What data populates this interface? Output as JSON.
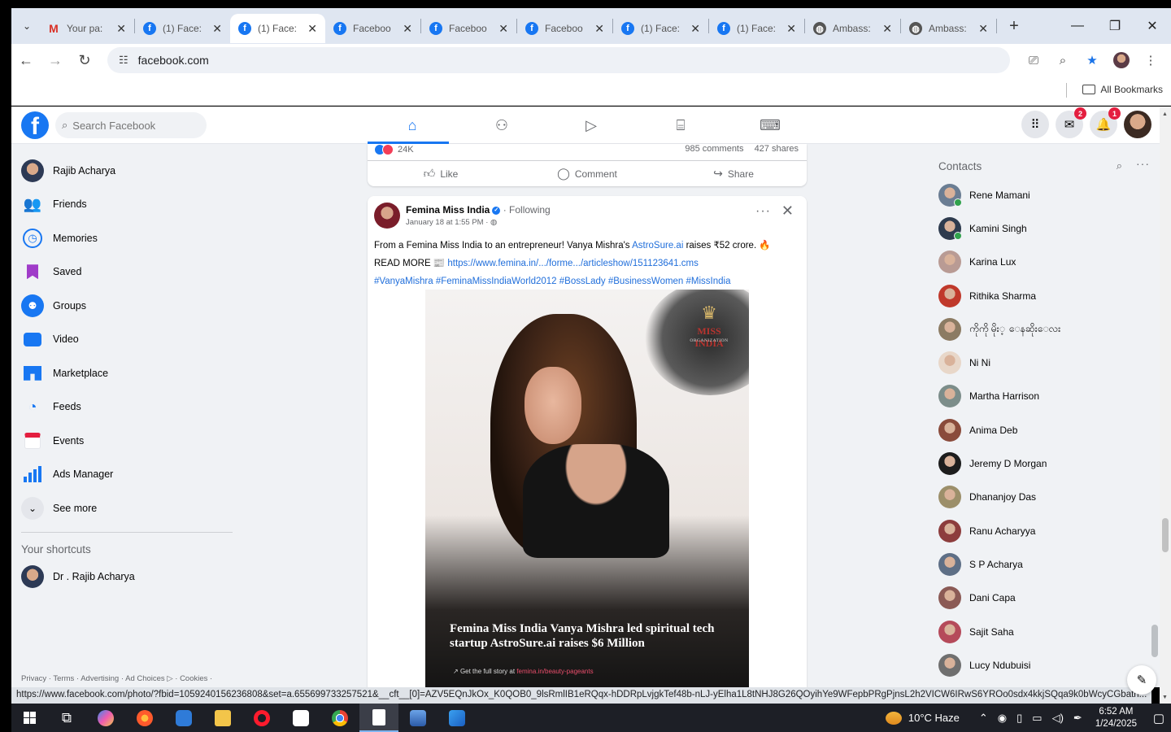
{
  "browser": {
    "tabs": [
      {
        "title": "Your pa:",
        "favicon": "gmail-icon",
        "active": false
      },
      {
        "title": "(1) Face:",
        "favicon": "facebook-icon",
        "active": false
      },
      {
        "title": "(1) Face:",
        "favicon": "facebook-icon",
        "active": true
      },
      {
        "title": "Faceboo",
        "favicon": "facebook-icon",
        "active": false
      },
      {
        "title": "Faceboo",
        "favicon": "facebook-icon",
        "active": false
      },
      {
        "title": "Faceboo",
        "favicon": "facebook-icon",
        "active": false
      },
      {
        "title": "(1) Face:",
        "favicon": "facebook-icon",
        "active": false
      },
      {
        "title": "(1) Face:",
        "favicon": "facebook-icon",
        "active": false
      },
      {
        "title": "Ambass:",
        "favicon": "globe-icon",
        "active": false
      },
      {
        "title": "Ambass:",
        "favicon": "globe-icon",
        "active": false
      }
    ],
    "url": "facebook.com",
    "all_bookmarks": "All Bookmarks",
    "status_url": "https://www.facebook.com/photo/?fbid=1059240156236808&set=a.655699733257521&__cft__[0]=AZV5EQnJkOx_K0QOB0_9lsRmlIB1eRQqx-hDDRpLvjgkTef48b-nLJ-yElha1L8tNHJ8G26QOyihYe9WFepbPRgPjnsL2h2VICW6IRwS6YROo0sdx4kkjSQqa9k0bWcyCGbath..."
  },
  "facebook": {
    "search_placeholder": "Search Facebook",
    "messenger_badge": "2",
    "notifications_badge": "1",
    "left_nav": [
      {
        "label": "Rajib Acharya",
        "icon": "profile-avatar"
      },
      {
        "label": "Friends",
        "icon": "friends-icon"
      },
      {
        "label": "Memories",
        "icon": "memories-icon"
      },
      {
        "label": "Saved",
        "icon": "saved-icon"
      },
      {
        "label": "Groups",
        "icon": "groups-icon"
      },
      {
        "label": "Video",
        "icon": "video-icon"
      },
      {
        "label": "Marketplace",
        "icon": "marketplace-icon"
      },
      {
        "label": "Feeds",
        "icon": "feeds-icon"
      },
      {
        "label": "Events",
        "icon": "events-icon"
      },
      {
        "label": "Ads Manager",
        "icon": "ads-manager-icon"
      },
      {
        "label": "See more",
        "icon": "chevron-down-icon"
      }
    ],
    "shortcuts_title": "Your shortcuts",
    "shortcuts": [
      {
        "label": "Dr . Rajib Acharya"
      }
    ],
    "footer": "Privacy · Terms · Advertising · Ad Choices ▷ · Cookies ·",
    "prev_post": {
      "reactions": "24K",
      "comments": "985 comments",
      "shares": "427 shares",
      "like": "Like",
      "comment": "Comment",
      "share": "Share"
    },
    "post": {
      "author": "Femina Miss India",
      "following": "· Following",
      "time": "January 18 at 1:55 PM · ",
      "text_intro": "From a Femina Miss India to an entrepreneur! Vanya Mishra's ",
      "text_link1": "AstroSure.ai",
      "text_rest": " raises ₹52 crore. 🔥",
      "read_more": "READ MORE 📰 ",
      "article_url": "https://www.femina.in/.../forme.../articleshow/151123641.cms",
      "hashtags": "#VanyaMishra #FeminaMissIndiaWorld2012 #BossLady #BusinessWomen #MissIndia",
      "image_logo": "MISS INDIA",
      "image_logo_sub": "ORGANIZATION",
      "image_headline": "Femina Miss India Vanya Mishra led spiritual tech startup AstroSure.ai raises $6 Million",
      "image_cta": "Get the full story at ",
      "image_cta_link": "femina.in/beauty-pageants"
    },
    "contacts_title": "Contacts",
    "contacts": [
      {
        "name": "Rene Mamani",
        "online": true,
        "color": "#6a7d93"
      },
      {
        "name": "Kamini Singh",
        "online": true,
        "color": "#2e3b4e"
      },
      {
        "name": "Karina Lux",
        "online": false,
        "color": "#b99b94"
      },
      {
        "name": "Rithika Sharma",
        "online": false,
        "color": "#c0392b"
      },
      {
        "name": "ကိုကို မိုး့ ေနဆိုးေလး",
        "online": false,
        "color": "#8c7b63"
      },
      {
        "name": "Ni Ni",
        "online": false,
        "color": "#e8d7c9"
      },
      {
        "name": "Martha Harrison",
        "online": false,
        "color": "#7c8d8a"
      },
      {
        "name": "Anima Deb",
        "online": false,
        "color": "#8a4b3b"
      },
      {
        "name": "Jeremy D Morgan",
        "online": false,
        "color": "#1d1d1d"
      },
      {
        "name": "Dhananjoy Das",
        "online": false,
        "color": "#9c8f6a"
      },
      {
        "name": "Ranu Acharyya",
        "online": false,
        "color": "#8d3d3d"
      },
      {
        "name": "S P Acharya",
        "online": false,
        "color": "#5e6f86"
      },
      {
        "name": "Dani Capa",
        "online": false,
        "color": "#8b5a55"
      },
      {
        "name": "Sajit Saha",
        "online": false,
        "color": "#b54a5a"
      },
      {
        "name": "Lucy Ndubuisi",
        "online": false,
        "color": "#6f6f6f"
      }
    ]
  },
  "taskbar": {
    "weather": "10°C  Haze",
    "time": "6:52 AM",
    "date": "1/24/2025"
  },
  "colors": {
    "facebook_blue": "#1877f2",
    "notification_red": "#e41e3f",
    "online_green": "#31a24c"
  }
}
